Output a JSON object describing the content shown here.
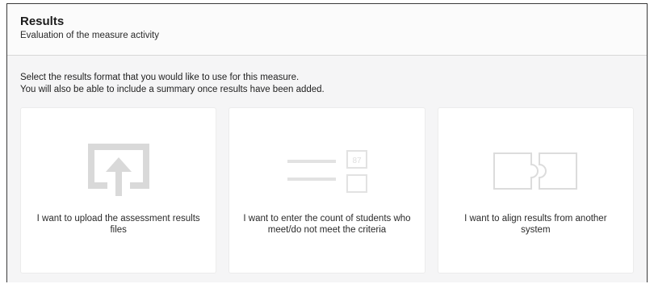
{
  "header": {
    "title": "Results",
    "subtitle": "Evaluation of the measure activity"
  },
  "instructions": {
    "line1": "Select the results format that you would like to use for this measure.",
    "line2": "You will also be able to include a summary once results have been added."
  },
  "options": [
    {
      "icon": "upload-icon",
      "label": "I want to upload the assessment results files"
    },
    {
      "icon": "count-entry-icon",
      "label": "I want to enter the count of students who meet/do not meet the criteria",
      "icon_text": "87"
    },
    {
      "icon": "puzzle-align-icon",
      "label": "I want to align results from another system"
    }
  ],
  "colors": {
    "icon_gray": "#d9d9d9",
    "panel_bg": "#f5f5f6",
    "card_bg": "#ffffff",
    "frame_border": "#3a3a3a"
  }
}
